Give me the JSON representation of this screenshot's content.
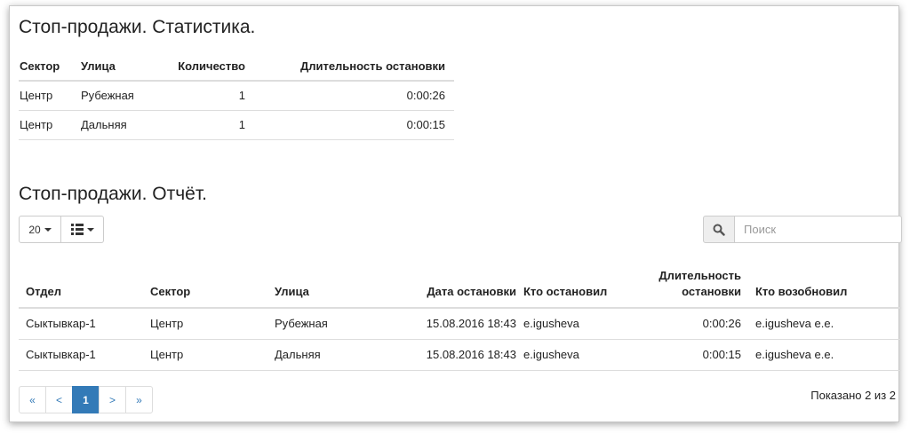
{
  "stats": {
    "title": "Стоп-продажи. Статистика.",
    "headers": [
      "Сектор",
      "Улица",
      "Количество",
      "Длительность остановки"
    ],
    "rows": [
      [
        "Центр",
        "Рубежная",
        "1",
        "0:00:26"
      ],
      [
        "Центр",
        "Дальняя",
        "1",
        "0:00:15"
      ]
    ]
  },
  "report": {
    "title": "Стоп-продажи. Отчёт.",
    "page_size": "20",
    "search_placeholder": "Поиск",
    "headers": [
      "Отдел",
      "Сектор",
      "Улица",
      "Дата остановки",
      "Кто остановил",
      "Длительность остановки",
      "Кто возобновил"
    ],
    "rows": [
      [
        "Сыктывкар-1",
        "Центр",
        "Рубежная",
        "15.08.2016 18:43",
        "e.igusheva",
        "0:00:26",
        "e.igusheva e.e."
      ],
      [
        "Сыктывкар-1",
        "Центр",
        "Дальняя",
        "15.08.2016 18:43",
        "e.igusheva",
        "0:00:15",
        "e.igusheva e.e."
      ]
    ],
    "pager": {
      "first": "«",
      "prev": "<",
      "current": "1",
      "next": ">",
      "last": "»"
    },
    "summary": "Показано 2 из 2"
  },
  "icons": {
    "search": "search-icon",
    "columns": "list-icon"
  },
  "colors": {
    "accent": "#337ab7",
    "border": "#dddddd"
  }
}
